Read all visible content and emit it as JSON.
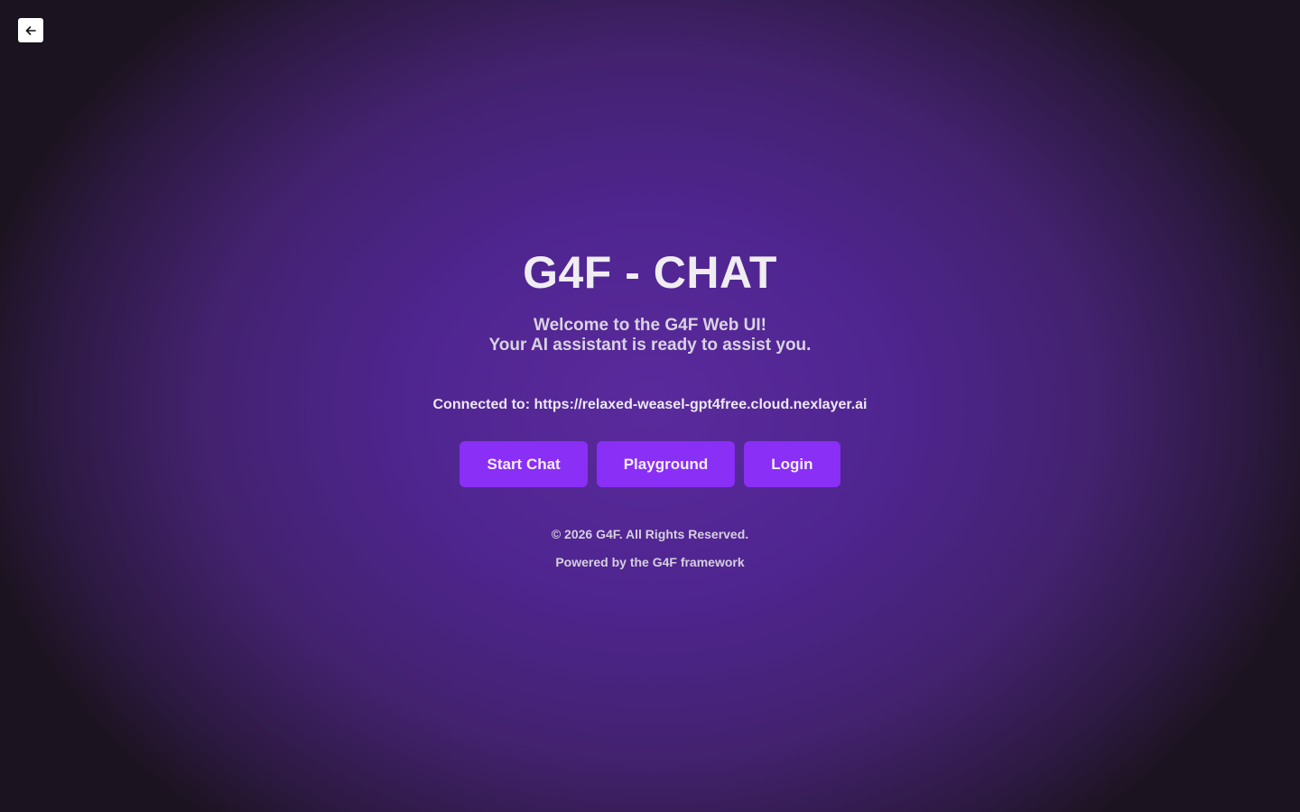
{
  "nav": {
    "back_icon": "arrow-left-icon"
  },
  "hero": {
    "title": "G4F - CHAT",
    "welcome_line_1": "Welcome to the G4F Web UI!",
    "welcome_line_2": "Your AI assistant is ready to assist you.",
    "connected": "Connected to: https://relaxed-weasel-gpt4free.cloud.nexlayer.ai"
  },
  "actions": {
    "start_chat": "Start Chat",
    "playground": "Playground",
    "login": "Login"
  },
  "footer": {
    "copyright": "© 2026 G4F. All Rights Reserved.",
    "powered_by": "Powered by the G4F framework"
  },
  "colors": {
    "accent": "#8a2ff5",
    "background_center": "#5a2a9c",
    "background_edge": "#1c1320"
  }
}
